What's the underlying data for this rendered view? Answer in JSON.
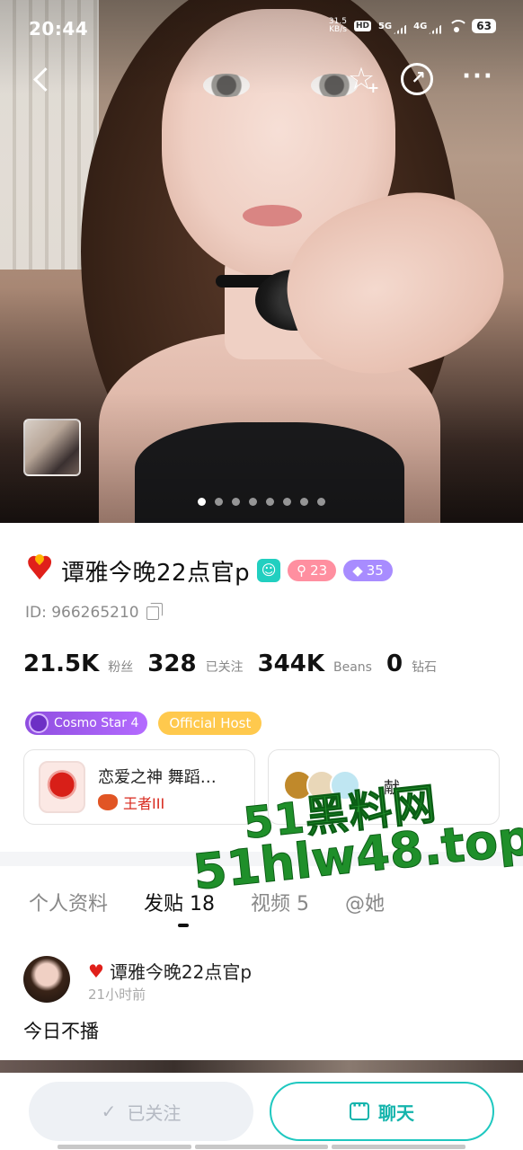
{
  "status_bar": {
    "time": "20:44",
    "speed_value": "31.5",
    "speed_unit": "KB/s",
    "hd1": "HD",
    "net1": "5G",
    "net2": "4G",
    "battery": "63"
  },
  "nav": {
    "back_icon": "chevron-left-icon",
    "star_icon": "star-add-icon",
    "share_icon": "share-icon",
    "more_icon": "more-icon",
    "star_glyph": "☆",
    "star_plus": "+",
    "more_glyph": "···"
  },
  "gallery": {
    "page_count": 8,
    "active_index": 0
  },
  "profile": {
    "name": "谭雅今晚22点官p",
    "verify_glyph": "☺",
    "level_badge": {
      "icon": "search-level-icon",
      "value": "23",
      "color": "#ff8fa0"
    },
    "gem_badge": {
      "icon": "diamond-icon",
      "value": "35",
      "color": "#a88cff"
    },
    "id_text": "ID: 966265210",
    "stats": [
      {
        "num": "21.5K",
        "label": "粉丝"
      },
      {
        "num": "328",
        "label": "已关注"
      },
      {
        "num": "344K",
        "label": "Beans"
      },
      {
        "num": "0",
        "label": "钻石"
      }
    ],
    "tags": {
      "cosmo": "Cosmo Star 4",
      "host": "Official Host"
    },
    "card1": {
      "title": "恋爱之神 舞蹈…",
      "rank": "王者III"
    },
    "card2": {
      "title": "献"
    }
  },
  "tabs": [
    {
      "label": "个人资料",
      "active": false
    },
    {
      "label": "发贴 18",
      "active": true
    },
    {
      "label": "视频 5",
      "active": false
    },
    {
      "label": "@她",
      "active": false
    }
  ],
  "post": {
    "author": "谭雅今晚22点官p",
    "time": "21小时前",
    "text": "今日不播"
  },
  "bottom": {
    "follow_label": "已关注",
    "follow_check": "✓",
    "chat_label": "聊天"
  },
  "watermark": {
    "line1": "51黑料网",
    "line2": "51hlw48.top"
  },
  "colors": {
    "accent": "#1fc8c0",
    "name_heart": "#e0201a",
    "host_tag": "#ffc94d",
    "cosmo_tag": "#a05cf0"
  }
}
